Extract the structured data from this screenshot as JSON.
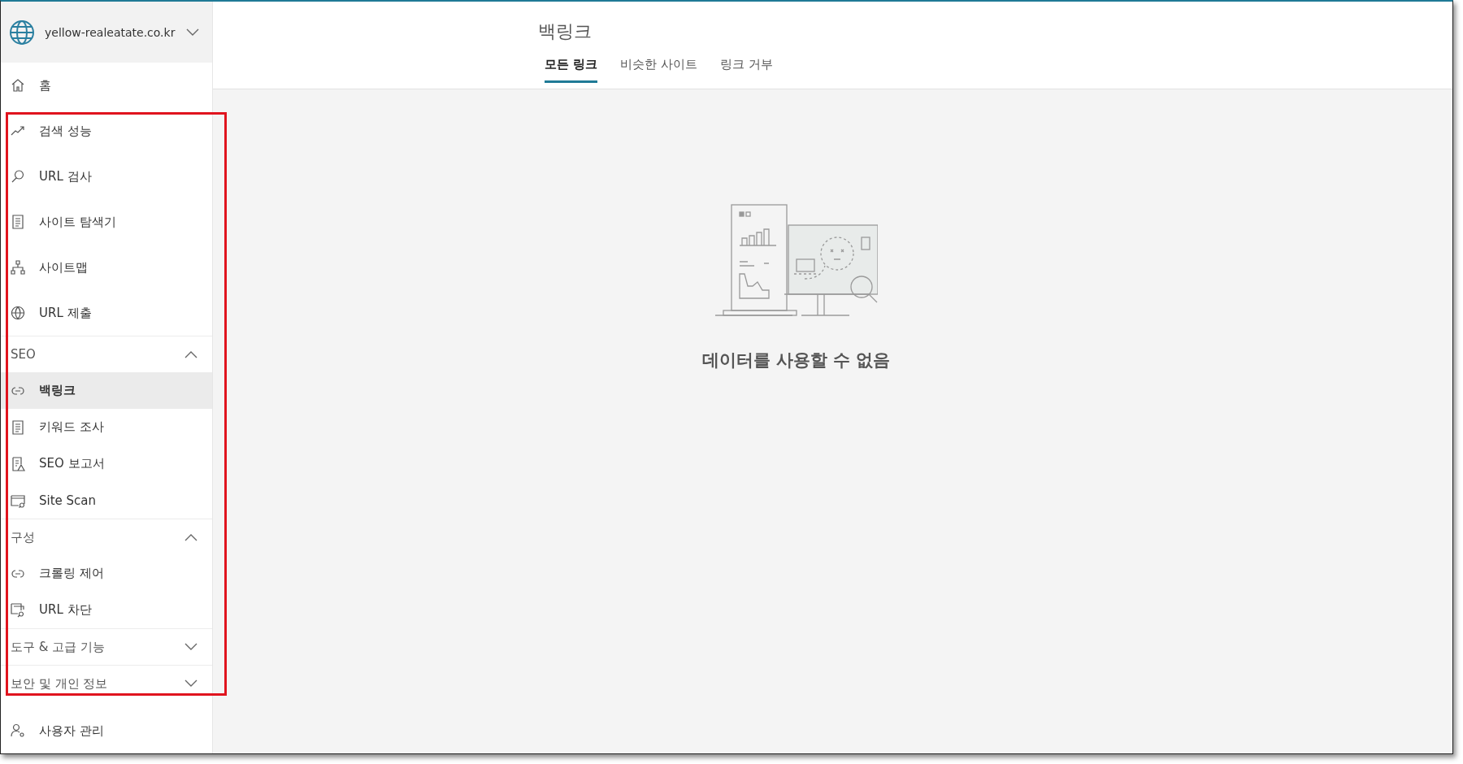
{
  "sidebar": {
    "site": {
      "name": "yellow-realeatate.co.kr",
      "expanded": false
    },
    "nav": [
      {
        "kind": "item",
        "label": "홈",
        "selected": false
      },
      {
        "kind": "item",
        "label": "검색 성능",
        "selected": false
      },
      {
        "kind": "item",
        "label": "URL 검사",
        "selected": false
      },
      {
        "kind": "item",
        "label": "사이트 탐색기",
        "selected": false
      },
      {
        "kind": "item",
        "label": "사이트맵",
        "selected": false
      },
      {
        "kind": "item",
        "label": "URL 제출",
        "selected": false
      },
      {
        "kind": "group",
        "label": "SEO",
        "expanded": true,
        "children": [
          {
            "label": "백링크",
            "selected": true
          },
          {
            "label": "키워드 조사",
            "selected": false
          },
          {
            "label": "SEO 보고서",
            "selected": false
          },
          {
            "label": "Site Scan",
            "selected": false
          }
        ]
      },
      {
        "kind": "group",
        "label": "구성",
        "expanded": true,
        "children": [
          {
            "label": "크롤링 제어",
            "selected": false
          },
          {
            "label": "URL 차단",
            "selected": false
          }
        ]
      },
      {
        "kind": "group",
        "label": "도구 & 고급 기능",
        "expanded": false
      },
      {
        "kind": "group",
        "label": "보안 및 개인 정보",
        "expanded": false
      },
      {
        "kind": "item",
        "label": "사용자 관리",
        "selected": false
      }
    ]
  },
  "page": {
    "title": "백링크",
    "tabs": [
      {
        "label": "모든 링크",
        "selected": true
      },
      {
        "label": "비슷한 사이트",
        "selected": false
      },
      {
        "label": "링크 거부",
        "selected": false
      }
    ],
    "empty_message": "데이터를 사용할 수 없음"
  }
}
